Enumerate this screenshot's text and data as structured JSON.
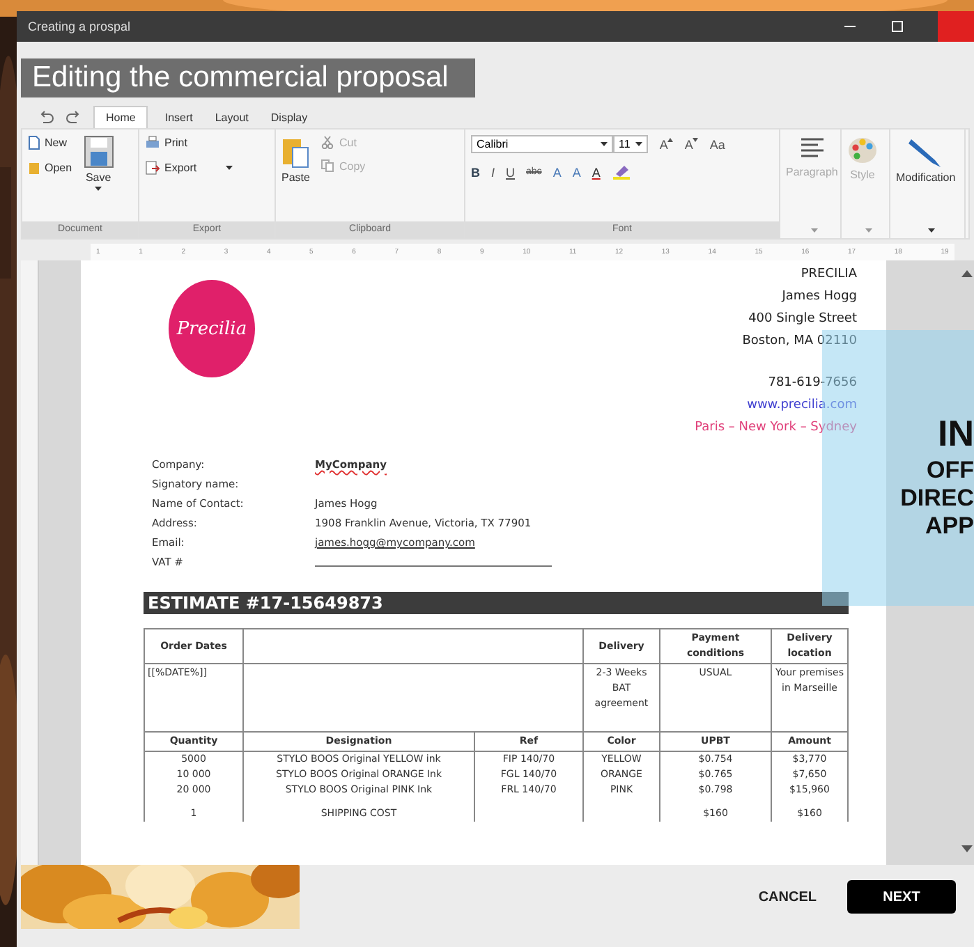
{
  "window": {
    "title": "Creating a prospal"
  },
  "header": "Editing the commercial proposal",
  "tabs": [
    {
      "label": "Home",
      "selected": true
    },
    {
      "label": "Insert",
      "selected": false
    },
    {
      "label": "Layout",
      "selected": false
    },
    {
      "label": "Display",
      "selected": false
    }
  ],
  "ribbon": {
    "document": {
      "new": "New",
      "open": "Open",
      "save": "Save",
      "label": "Document"
    },
    "export": {
      "print": "Print",
      "export": "Export",
      "label": "Export"
    },
    "clipboard": {
      "paste": "Paste",
      "cut": {
        "label": "Cut",
        "disabled": true
      },
      "copy": {
        "label": "Copy",
        "disabled": true
      },
      "label": "Clipboard"
    },
    "font": {
      "name": "Calibri",
      "size": "11",
      "grow": "A",
      "shrink": "A",
      "case": "Aa",
      "styles": [
        "B",
        "I",
        "U",
        "abc",
        "A",
        "A"
      ],
      "color_button": "A",
      "label": "Font"
    },
    "paragraph": {
      "label": "Paragraph",
      "disabled": true
    },
    "style": {
      "label": "Style",
      "disabled": true
    },
    "modification": {
      "label": "Modification",
      "disabled": false
    }
  },
  "ruler": [
    "1",
    "1",
    "2",
    "3",
    "4",
    "5",
    "6",
    "7",
    "8",
    "9",
    "10",
    "11",
    "12",
    "13",
    "14",
    "15",
    "16",
    "17",
    "18",
    "19"
  ],
  "document": {
    "logo": "Precilia",
    "sender": [
      "PRECILIA",
      "James Hogg",
      "400 Single Street",
      "Boston, MA 02110"
    ],
    "phone": "781-619-7656",
    "website": "www.precilia.com",
    "cities": "Paris – New York – Sydney",
    "client": [
      {
        "label": "Company:",
        "value": "MyCompany",
        "kind": "spell"
      },
      {
        "label": "Signatory name:",
        "kind": "text"
      },
      {
        "label": "Name of Contact:",
        "value": "James Hogg",
        "kind": "text"
      },
      {
        "label": "Address:",
        "value": "1908 Franklin Avenue, Victoria, TX 77901",
        "kind": "text"
      },
      {
        "label": "Email:",
        "value": "james.hogg@mycompany.com",
        "kind": "link"
      },
      {
        "label": "VAT #",
        "kind": "blank"
      }
    ],
    "estimate": "ESTIMATE #17-15649873",
    "terms": {
      "headers": [
        "Order Dates",
        "Delivery",
        "Payment conditions",
        "Delivery location"
      ],
      "values": [
        "[[%DATE%]]",
        "2-3 Weeks BAT agreement",
        "USUAL",
        "Your premises in Marseille"
      ]
    },
    "columns": [
      "Quantity",
      "Designation",
      "Ref",
      "Color",
      "UPBT",
      "Amount"
    ],
    "lines": [
      {
        "quantity": "5000",
        "designation": "STYLO BOOS Original YELLOW ink",
        "ref": "FIP 140/70",
        "ink": "YELLOW",
        "upbt": "$0.754",
        "amount": "$3,770"
      },
      {
        "quantity": "10 000",
        "designation": "STYLO BOOS Original ORANGE Ink",
        "ref": "FGL 140/70",
        "ink": "ORANGE",
        "upbt": "$0.765",
        "amount": "$7,650"
      },
      {
        "quantity": "20 000",
        "designation": "STYLO BOOS Original PINK Ink",
        "ref": "FRL 140/70",
        "ink": "PINK",
        "upbt": "$0.798",
        "amount": "$15,960"
      },
      {
        "quantity": "1",
        "designation": "SHIPPING COST",
        "upbt": "$160",
        "amount": "$160"
      }
    ]
  },
  "promo": [
    "IN",
    "OFF",
    "DIREC",
    "APP"
  ],
  "buttons": {
    "cancel": "CANCEL",
    "next": "NEXT"
  }
}
